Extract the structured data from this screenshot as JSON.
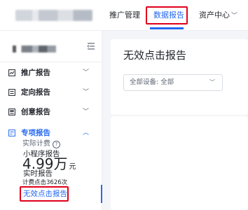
{
  "topnav": {
    "items": [
      {
        "label": "推广管理"
      },
      {
        "label": "数据报告"
      },
      {
        "label": "资产中心"
      }
    ],
    "accent_color": "#2468f2",
    "highlight_color": "#e0001b"
  },
  "sidebar": {
    "groups": [
      {
        "label": "推广报告",
        "icon": "chart-icon"
      },
      {
        "label": "定向报告",
        "icon": "target-list-icon"
      },
      {
        "label": "创意报告",
        "icon": "creative-icon"
      },
      {
        "label": "专项报告",
        "icon": "special-report-icon"
      }
    ],
    "sub_items": [
      {
        "label": "小程序报告"
      },
      {
        "label": "实时报告"
      },
      {
        "label": "无效点击报告"
      }
    ]
  },
  "main": {
    "title": "无效点击报告",
    "device_filter": {
      "label": "全部设备:",
      "value": "全部"
    },
    "stat": {
      "label": "实际计费",
      "value": "4.99万",
      "unit": "元",
      "sub": "计费点击3626次"
    }
  }
}
